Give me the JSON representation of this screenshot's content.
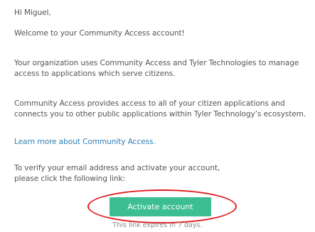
{
  "email": {
    "greeting": "Hi Miguel,",
    "welcome": "Welcome to your Community Access account!",
    "organization_text": "Your organization uses Community Access and Tyler Technologies to manage access to applications which serve citizens.",
    "provides_text": "Community Access provides access to all of your citizen applications and connects you to other public applications within Tyler Technology’s ecosystem.",
    "learn_more_link": "Learn more about Community Access.",
    "verify_text_line1": "To verify your email address and activate your account,",
    "verify_text_line2": "please click the following link:",
    "activate_button": "Activate account",
    "expiry_note": "This link expires in 7 days."
  },
  "colors": {
    "button": "#3dbd92",
    "link": "#2e7fb8",
    "annotation_ring": "#e31b1b"
  }
}
